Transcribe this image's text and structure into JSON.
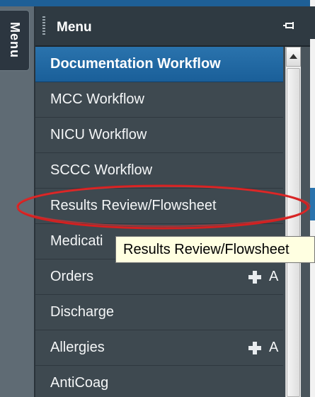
{
  "side_tab": {
    "label": "Menu"
  },
  "panel": {
    "title": "Menu",
    "items": [
      {
        "label": "Documentation Workflow"
      },
      {
        "label": "MCC Workflow"
      },
      {
        "label": "NICU Workflow"
      },
      {
        "label": "SCCC Workflow"
      },
      {
        "label": "Results Review/Flowsheet"
      },
      {
        "label": "Medicati"
      },
      {
        "label": "Orders",
        "add_text": "A"
      },
      {
        "label": "Discharge"
      },
      {
        "label": "Allergies",
        "add_text": "A"
      },
      {
        "label": "AntiCoag"
      }
    ]
  },
  "tooltip": {
    "text": "Results Review/Flowsheet"
  },
  "colors": {
    "selected": "#1a5f99",
    "panel": "#3e4950",
    "annotation": "#d42020",
    "tooltip": "#ffffe1"
  }
}
